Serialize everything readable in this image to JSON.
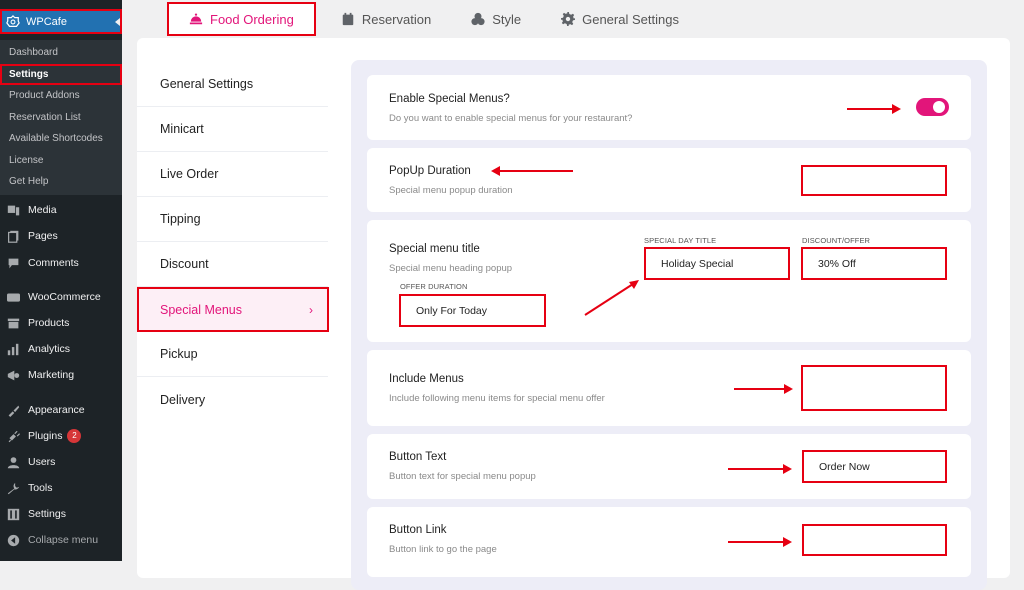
{
  "wp_menu": {
    "plugin_title": "WPCafe",
    "submenu": [
      {
        "label": "Dashboard",
        "active": false
      },
      {
        "label": "Settings",
        "active": true
      },
      {
        "label": "Product Addons",
        "active": false
      },
      {
        "label": "Reservation List",
        "active": false
      },
      {
        "label": "Available Shortcodes",
        "active": false
      },
      {
        "label": "License",
        "active": false
      },
      {
        "label": "Get Help",
        "active": false
      }
    ],
    "items": [
      {
        "label": "Media",
        "icon": "media-icon"
      },
      {
        "label": "Pages",
        "icon": "pages-icon"
      },
      {
        "label": "Comments",
        "icon": "comments-icon"
      },
      {
        "label": "WooCommerce",
        "icon": "woocommerce-icon"
      },
      {
        "label": "Products",
        "icon": "products-icon"
      },
      {
        "label": "Analytics",
        "icon": "analytics-icon"
      },
      {
        "label": "Marketing",
        "icon": "marketing-icon"
      },
      {
        "label": "Appearance",
        "icon": "appearance-icon"
      },
      {
        "label": "Plugins",
        "icon": "plugins-icon",
        "badge": "2"
      },
      {
        "label": "Users",
        "icon": "users-icon"
      },
      {
        "label": "Tools",
        "icon": "tools-icon"
      },
      {
        "label": "Settings",
        "icon": "settings-icon"
      },
      {
        "label": "Collapse menu",
        "icon": "collapse-icon"
      }
    ]
  },
  "tabs": [
    {
      "label": "Food Ordering",
      "icon": "food-bell-icon",
      "active": true
    },
    {
      "label": "Reservation",
      "icon": "calendar-icon",
      "active": false
    },
    {
      "label": "Style",
      "icon": "palette-icon",
      "active": false
    },
    {
      "label": "General Settings",
      "icon": "gear-icon",
      "active": false
    }
  ],
  "sub_nav": [
    {
      "label": "General Settings",
      "active": false
    },
    {
      "label": "Minicart",
      "active": false
    },
    {
      "label": "Live Order",
      "active": false
    },
    {
      "label": "Tipping",
      "active": false
    },
    {
      "label": "Discount",
      "active": false
    },
    {
      "label": "Special Menus",
      "active": true,
      "chevron": "›"
    },
    {
      "label": "Pickup",
      "active": false
    },
    {
      "label": "Delivery",
      "active": false
    }
  ],
  "settings": {
    "enable": {
      "label": "Enable Special Menus?",
      "desc": "Do you want to enable special menus for your restaurant?",
      "enabled": true
    },
    "popup_duration": {
      "label": "PopUp Duration",
      "desc": "Special menu popup duration",
      "value": ""
    },
    "special_title": {
      "label": "Special menu title",
      "desc": "Special menu heading popup",
      "offer_duration_label": "OFFER DURATION",
      "offer_duration_value": "Only For Today",
      "special_day_label": "SPECIAL DAY TITLE",
      "special_day_value": "Holiday Special",
      "discount_label": "DISCOUNT/OFFER",
      "discount_value": "30% Off"
    },
    "include_menus": {
      "label": "Include Menus",
      "desc": "Include following menu items for special menu offer",
      "value": ""
    },
    "button_text": {
      "label": "Button Text",
      "desc": "Button text for special menu popup",
      "value": "Order Now"
    },
    "button_link": {
      "label": "Button Link",
      "desc": "Button link to go the page",
      "value": ""
    }
  },
  "colors": {
    "accent": "#e2157a",
    "annotation": "#e60012",
    "wp_blue": "#2271b1"
  }
}
